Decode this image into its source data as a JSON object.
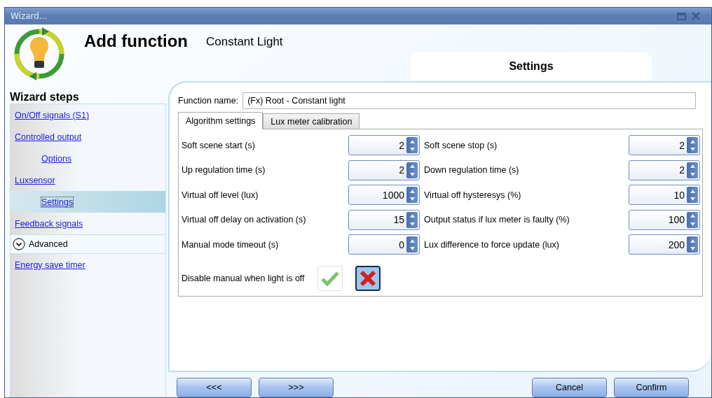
{
  "window": {
    "title": "Wizard..."
  },
  "header": {
    "title": "Add function",
    "subtitle": "Constant Light"
  },
  "page_tab": {
    "label": "Settings"
  },
  "sidebar": {
    "title": "Wizard steps",
    "items": [
      {
        "kind": "link",
        "label": "On/Off signals (S1)",
        "selected": false
      },
      {
        "kind": "link",
        "label": "Controlled output",
        "selected": false,
        "children": [
          {
            "kind": "link",
            "label": "Options",
            "selected": false
          }
        ]
      },
      {
        "kind": "link",
        "label": "Luxsensor",
        "selected": false,
        "children": [
          {
            "kind": "link",
            "label": "Settings",
            "selected": true
          }
        ]
      },
      {
        "kind": "link",
        "label": "Feedback signals",
        "selected": false
      },
      {
        "kind": "section",
        "label": "Advanced",
        "expanded": true
      },
      {
        "kind": "link",
        "label": "Energy save timer",
        "selected": false
      }
    ]
  },
  "function_name": {
    "label": "Function name:",
    "value": "(Fx) Root - Constant light"
  },
  "tabs": [
    {
      "label": "Algorithm settings",
      "selected": true
    },
    {
      "label": "Lux meter calibration",
      "selected": false
    }
  ],
  "fields_left": [
    {
      "label": "Soft scene start (s)",
      "value": "2"
    },
    {
      "label": "Up regulation time (s)",
      "value": "2"
    },
    {
      "label": "Virtual off level (lux)",
      "value": "1000"
    },
    {
      "label": "Virtual off delay on activation (s)",
      "value": "15"
    },
    {
      "label": "Manual mode timeout (s)",
      "value": "0"
    }
  ],
  "fields_right": [
    {
      "label": "Soft scene stop (s)",
      "value": "2"
    },
    {
      "label": "Down regulation time (s)",
      "value": "2"
    },
    {
      "label": "Virtual off hysteresys (%)",
      "value": "10"
    },
    {
      "label": "Output status if lux meter is faulty (%)",
      "value": "100"
    },
    {
      "label": "Lux difference to force update (lux)",
      "value": "200"
    }
  ],
  "disable_manual": {
    "label": "Disable manual when light is off",
    "choices": [
      {
        "kind": "yes",
        "selected": false
      },
      {
        "kind": "no",
        "selected": true
      }
    ]
  },
  "buttons": {
    "back": "<<<",
    "next": ">>>",
    "cancel": "Cancel",
    "confirm": "Confirm"
  }
}
